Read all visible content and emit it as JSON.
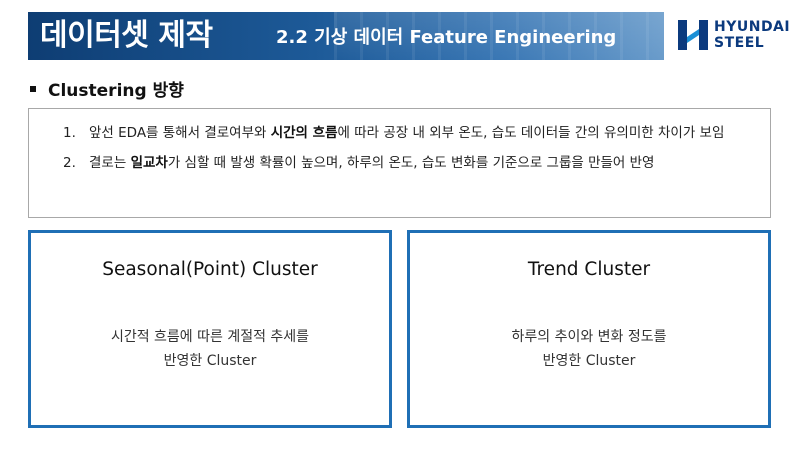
{
  "header": {
    "title": "데이터셋 제작",
    "subtitle": "2.2 기상 데이터 Feature Engineering"
  },
  "logo": {
    "line1": "HYUNDAI",
    "line2": "STEEL",
    "color": "#0b3a7e"
  },
  "section": {
    "heading": "Clustering 방향"
  },
  "summary": {
    "items": [
      {
        "number": "1.",
        "before": "앞선 EDA를 통해서 결로여부와 ",
        "bold": "시간의 흐름",
        "after": "에 따라 공장 내 외부 온도, 습도 데이터들 간의 유의미한 차이가 보임"
      },
      {
        "number": "2.",
        "before": "결로는 ",
        "bold": "일교차",
        "after": "가 심할 때 발생 확률이 높으며, 하루의 온도, 습도 변화를 기준으로 그룹을 만들어 반영"
      }
    ]
  },
  "cards": [
    {
      "title": "Seasonal(Point) Cluster",
      "desc_line1": "시간적 흐름에 따른 계절적 추세를",
      "desc_line2": "반영한 Cluster"
    },
    {
      "title": "Trend Cluster",
      "desc_line1": "하루의 추이와 변화 정도를",
      "desc_line2": "반영한 Cluster"
    }
  ],
  "colors": {
    "header_bg": "#1d5a98",
    "card_border": "#1f6fb5"
  }
}
